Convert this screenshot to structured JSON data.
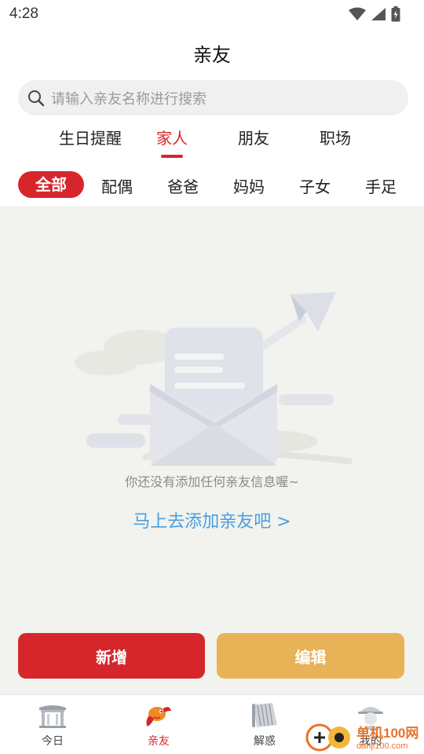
{
  "status_bar": {
    "time": "4:28"
  },
  "header": {
    "title": "亲友"
  },
  "search": {
    "placeholder": "请输入亲友名称进行搜索"
  },
  "category_tabs": [
    {
      "label": "生日提醒",
      "active": false
    },
    {
      "label": "家人",
      "active": true
    },
    {
      "label": "朋友",
      "active": false
    },
    {
      "label": "职场",
      "active": false
    }
  ],
  "sub_tabs": [
    {
      "label": "全部",
      "active": true
    },
    {
      "label": "配偶",
      "active": false
    },
    {
      "label": "爸爸",
      "active": false
    },
    {
      "label": "妈妈",
      "active": false
    },
    {
      "label": "子女",
      "active": false
    },
    {
      "label": "手足",
      "active": false
    }
  ],
  "empty_state": {
    "message": "你还没有添加任何亲友信息喔~",
    "link": "马上去添加亲友吧 >"
  },
  "actions": {
    "add_label": "新增",
    "edit_label": "编辑"
  },
  "bottom_nav": [
    {
      "label": "今日",
      "icon": "gate-icon",
      "active": false
    },
    {
      "label": "亲友",
      "icon": "koi-fish-icon",
      "active": true
    },
    {
      "label": "解惑",
      "icon": "scroll-icon",
      "active": false
    },
    {
      "label": "我的",
      "icon": "monk-avatar-icon",
      "active": false
    }
  ],
  "watermark": {
    "title": "单机100网",
    "url": "danji100.com"
  },
  "colors": {
    "accent": "#d6262c",
    "edit_button": "#e8b256",
    "link": "#4a9fe0",
    "content_bg": "#f2f2ee",
    "watermark": "#e8732a"
  }
}
